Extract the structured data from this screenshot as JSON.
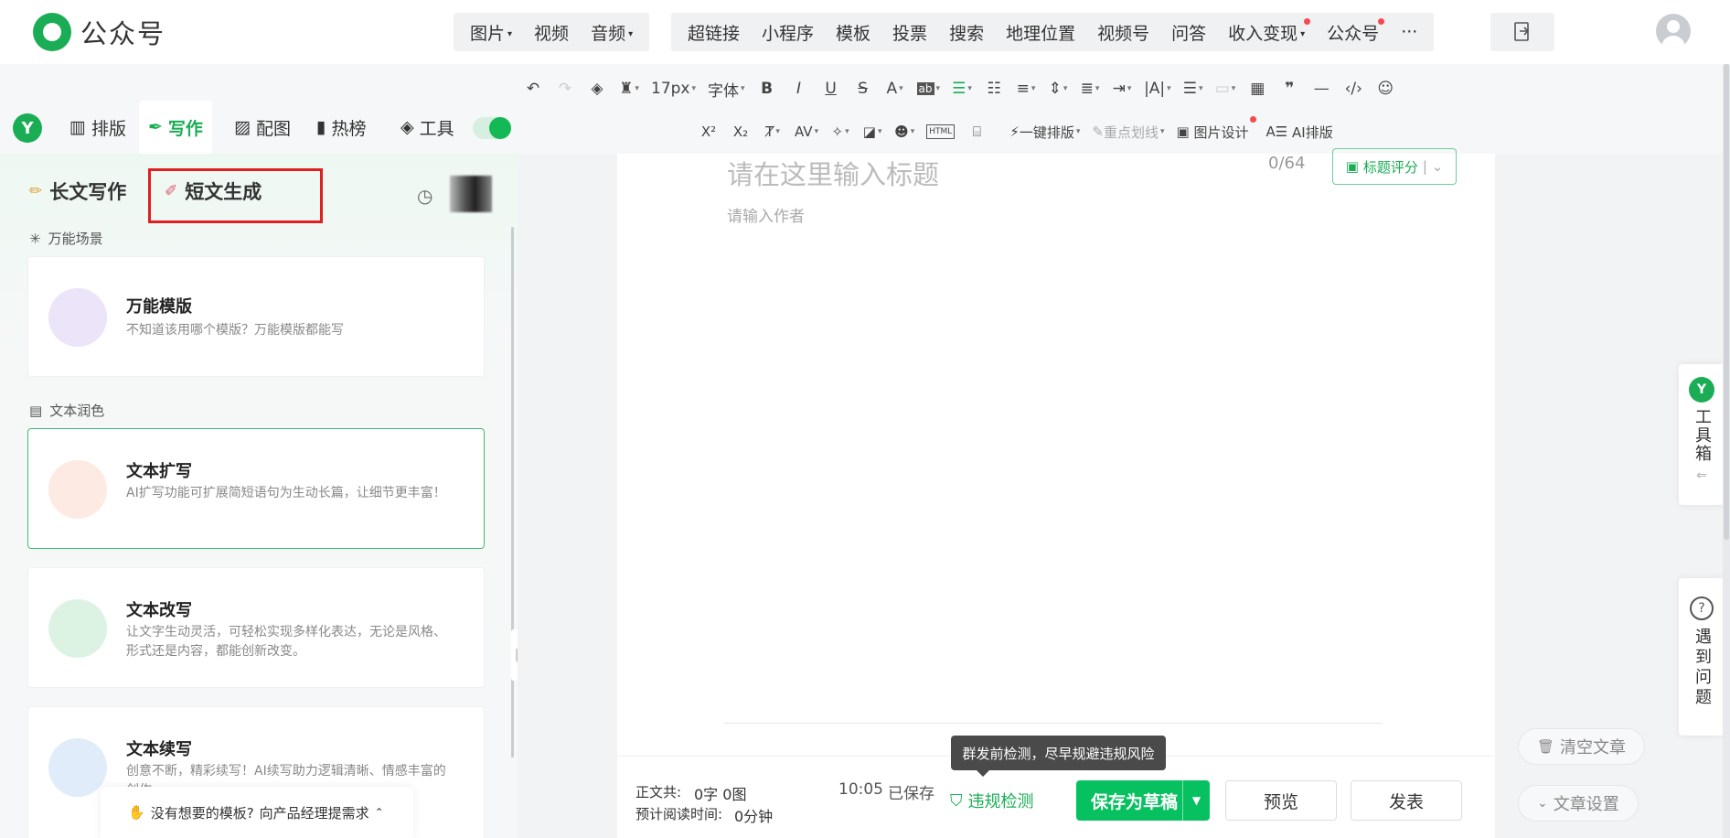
{
  "app": {
    "name": "公众号"
  },
  "topnav": {
    "group1": [
      {
        "label": "图片",
        "caret": true
      },
      {
        "label": "视频",
        "caret": false
      },
      {
        "label": "音频",
        "caret": true
      }
    ],
    "group2": [
      {
        "label": "超链接",
        "caret": false,
        "dot": false
      },
      {
        "label": "小程序",
        "caret": false,
        "dot": false
      },
      {
        "label": "模板",
        "caret": false,
        "dot": false
      },
      {
        "label": "投票",
        "caret": false,
        "dot": false
      },
      {
        "label": "搜索",
        "caret": false,
        "dot": false
      },
      {
        "label": "地理位置",
        "caret": false,
        "dot": false
      },
      {
        "label": "视频号",
        "caret": false,
        "dot": false
      },
      {
        "label": "问答",
        "caret": false,
        "dot": false
      },
      {
        "label": "收入变现",
        "caret": true,
        "dot": true
      },
      {
        "label": "公众号",
        "caret": false,
        "dot": true
      },
      {
        "label": "···",
        "caret": false,
        "dot": false
      }
    ]
  },
  "toolbar": {
    "font_size": "17px",
    "font_family": "字体",
    "row2": {
      "one_click_layout": "一键排版",
      "key_underline": "重点划线",
      "image_design": "图片设计",
      "ai_layout": "AI排版"
    }
  },
  "plugin": {
    "logo_letter": "Y",
    "tabs": [
      {
        "label": "排版",
        "active": false
      },
      {
        "label": "写作",
        "active": true
      },
      {
        "label": "配图",
        "active": false
      },
      {
        "label": "热榜",
        "active": false
      },
      {
        "label": "工具",
        "active": false
      }
    ]
  },
  "left": {
    "tab_long": "长文写作",
    "tab_short": "短文生成",
    "section1": "万能场景",
    "section2": "文本润色",
    "cards": [
      {
        "title": "万能模版",
        "desc": "不知道该用哪个模版？万能模版都能写",
        "color": "#ece4f8"
      },
      {
        "title": "文本扩写",
        "desc": "AI扩写功能可扩展简短语句为生动长篇，让细节更丰富！",
        "color": "#fdeae2"
      },
      {
        "title": "文本改写",
        "desc": "让文字生动灵活，可轻松实现多样化表达，无论是风格、形式还是内容，都能创新改变。",
        "color": "#dcf3e4"
      },
      {
        "title": "文本续写",
        "desc": "创意不断，精彩续写！AI续写助力逻辑清晰、情感丰富的创作",
        "color": "#e1ecfb"
      }
    ],
    "bottom_tip_text": "没有想要的模板?",
    "bottom_tip_link": "向产品经理提需求"
  },
  "editor": {
    "title_placeholder": "请在这里输入标题",
    "title_count": "0/64",
    "title_score": "标题评分",
    "author_placeholder": "请输入作者"
  },
  "bottom": {
    "word_count_label": "正文共:",
    "word_count_value": "0字 0图",
    "read_time_label": "预计阅读时间:",
    "read_time_value": "0分钟",
    "saved_time": "10:05",
    "saved_label": "已保存",
    "tooltip": "群发前检测，尽早规避违规风险",
    "check_label": "违规检测",
    "save_draft": "保存为草稿",
    "preview": "预览",
    "publish": "发表"
  },
  "side": {
    "toolbox_letter": "Y",
    "toolbox_label": "工具箱",
    "help_label": "遇到问题",
    "clear_article": "清空文章",
    "article_settings": "文章设置"
  },
  "colors": {
    "accent": "#07c160",
    "highlight_box": "#e02020"
  }
}
